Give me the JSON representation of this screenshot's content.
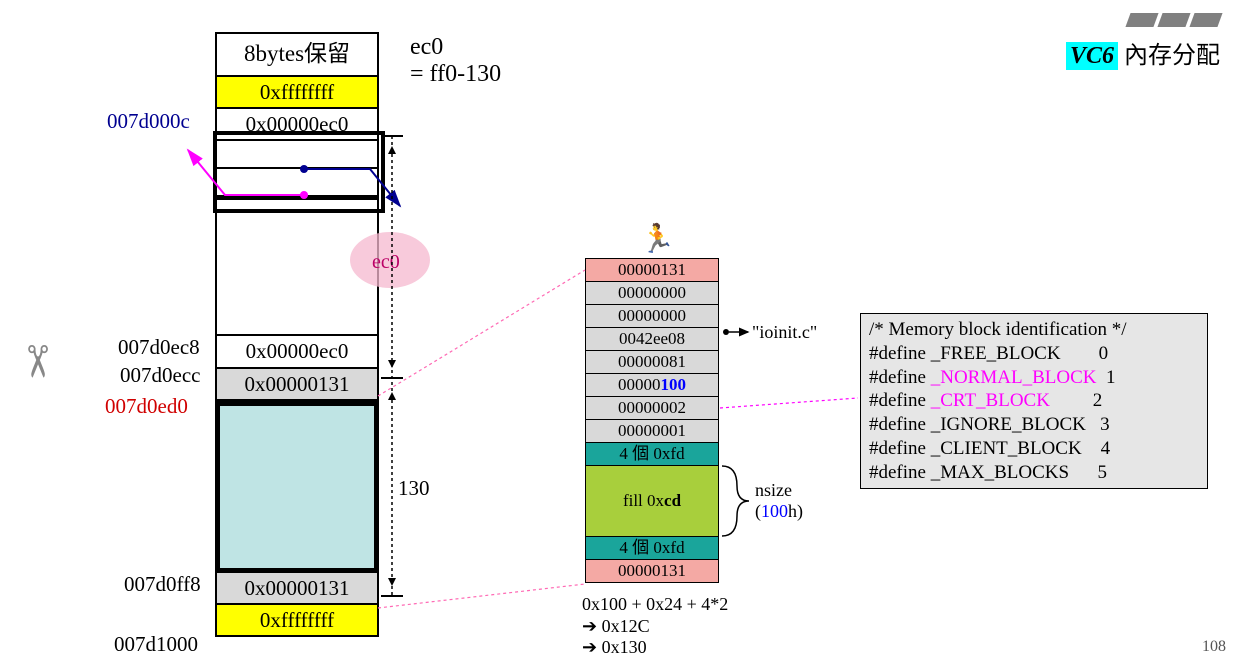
{
  "title": {
    "vc6": "VC6",
    "rest": " 內存分配"
  },
  "note_ec0_line1": "ec0",
  "note_ec0_line2": "= ff0-130",
  "label_span_130": "130",
  "bracket_ec0": "ec0",
  "page_number": "108",
  "addr": {
    "a0": "007d000c",
    "a1": "007d0ec8",
    "a2": "007d0ecc",
    "a3_red": "007d0ed0",
    "a4": "007d0ff8",
    "a5": "007d1000"
  },
  "stack": {
    "reserved": "8bytes保留",
    "ffff1": "0xffffffff",
    "ec0_1": "0x00000ec0",
    "ec0_2": "0x00000ec0",
    "h131_1": "0x00000131",
    "h131_2": "0x00000131",
    "ffff2": "0xffffffff"
  },
  "block": {
    "r0": "00000131",
    "r1": "00000000",
    "r2": "00000000",
    "r3": "0042ee08",
    "r4": "00000081",
    "r5_prefix": "00000",
    "r5_highlight": "100",
    "r6": "00000002",
    "r7": "00000001",
    "fd_top": "4 個 0xfd",
    "fill_prefix": "fill 0x",
    "fill_bold": "cd",
    "fd_bot": "4 個 0xfd",
    "r_end": "00000131",
    "ioinit": "\"ioinit.c\"",
    "nsize_lbl": "nsize",
    "nsize_hex_pre": "(",
    "nsize_hex": "100",
    "nsize_hex_post": "h)",
    "calc1": "0x100 + 0x24 + 4*2",
    "calc2": "➔ 0x12C",
    "calc3": "➔ 0x130"
  },
  "code": {
    "c0": "/* Memory block identification */",
    "c1a": "#define ",
    "c1b": "_FREE_BLOCK",
    "c1v": "0",
    "c2a": "#define ",
    "c2b": "_NORMAL_BLOCK",
    "c2v": "1",
    "c3a": "#define ",
    "c3b": "_CRT_BLOCK",
    "c3v": "2",
    "c4a": "#define ",
    "c4b": "_IGNORE_BLOCK",
    "c4v": "3",
    "c5a": "#define ",
    "c5b": "_CLIENT_BLOCK",
    "c5v": "4",
    "c6a": "#define ",
    "c6b": "_MAX_BLOCKS",
    "c6v": "5"
  }
}
